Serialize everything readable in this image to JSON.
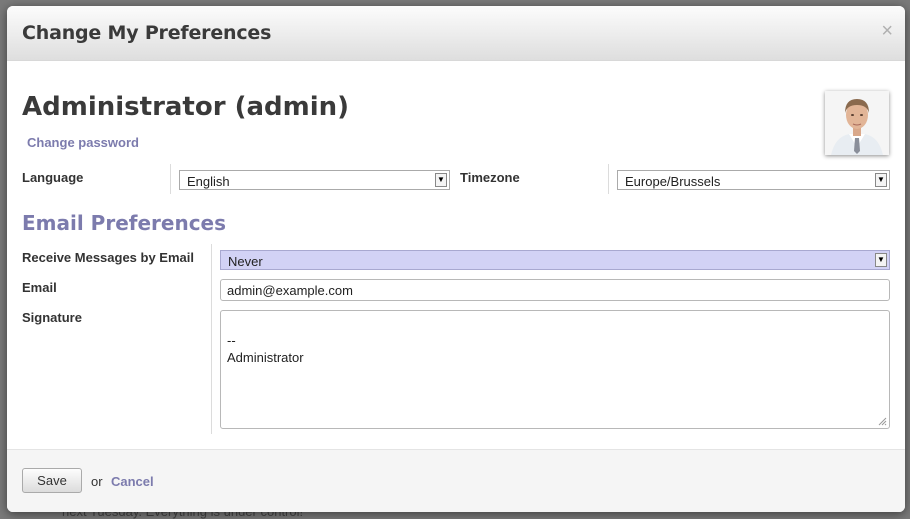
{
  "background": {
    "partial_text": "next Tuesday. Everything is under control!"
  },
  "dialog": {
    "title": "Change My Preferences",
    "close_icon": "×"
  },
  "user": {
    "name": "Administrator (admin)",
    "change_password": "Change password"
  },
  "fields": {
    "language": {
      "label": "Language",
      "value": "English"
    },
    "timezone": {
      "label": "Timezone",
      "value": "Europe/Brussels"
    }
  },
  "email_prefs": {
    "title": "Email Preferences",
    "receive": {
      "label": "Receive Messages by Email",
      "value": "Never"
    },
    "email": {
      "label": "Email",
      "value": "admin@example.com"
    },
    "signature": {
      "label": "Signature",
      "value": "--\nAdministrator"
    }
  },
  "footer": {
    "save": "Save",
    "or": "or",
    "cancel": "Cancel"
  },
  "colors": {
    "accent": "#7c7bad",
    "highlight": "#d2d2f5"
  },
  "icons": {
    "dropdown": "dropdown-arrow-icon",
    "close": "close-icon",
    "resize": "resize-grip-icon"
  }
}
